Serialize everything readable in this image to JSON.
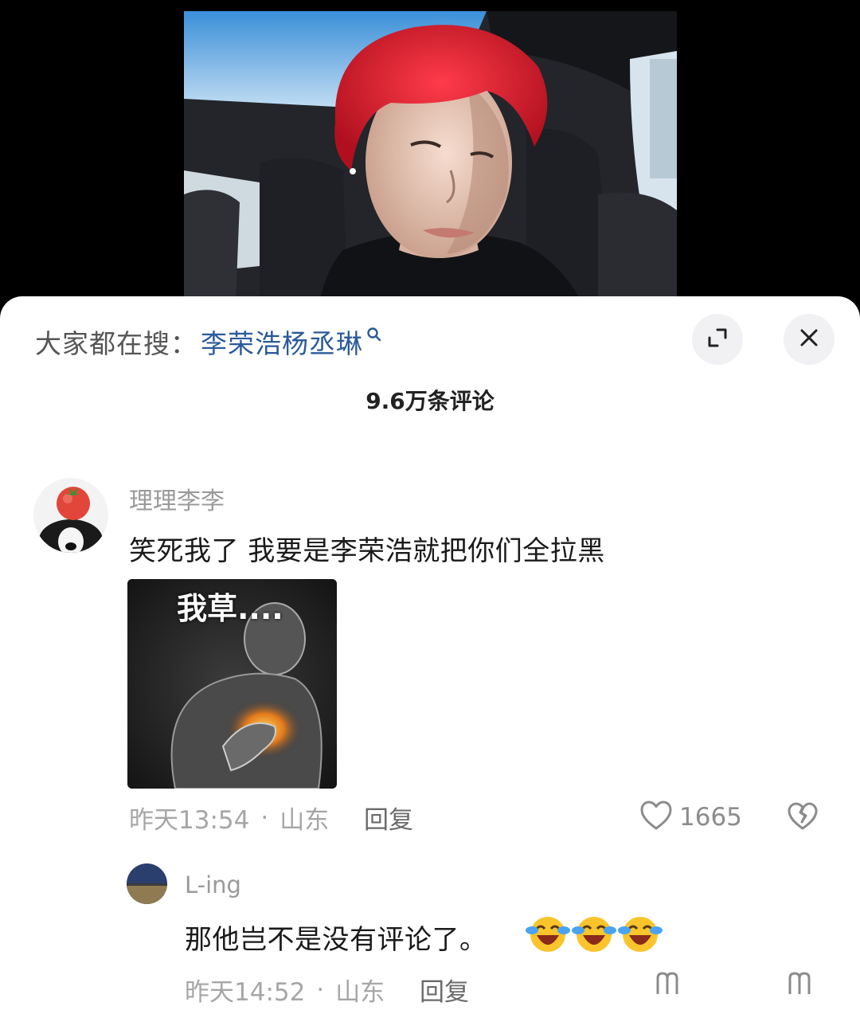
{
  "search": {
    "prefix": "大家都在搜：",
    "query": "李荣浩杨丞琳"
  },
  "comments_header": {
    "count_label": "9.6万条评论"
  },
  "comments": [
    {
      "username": "理理李李",
      "text": "笑死我了 我要是李荣浩就把你们全拉黑",
      "image_caption": "我草....",
      "time": "昨天13:54",
      "location": "山东",
      "reply_label": "回复",
      "likes": "1665"
    }
  ],
  "replies": [
    {
      "username": "L-ing",
      "text": "那他岂不是没有评论了。",
      "emoji": "laughing-crying-face",
      "emoji_count": 3,
      "time": "昨天14:52",
      "location": "山东",
      "reply_label": "回复"
    }
  ],
  "icons": {
    "search": "magnifier-icon",
    "expand": "expand-icon",
    "close": "close-icon",
    "like": "heart-icon",
    "dislike": "broken-heart-icon"
  },
  "colors": {
    "link": "#2a5a9a",
    "muted": "#a6a6a6",
    "text": "#1a1a1a"
  }
}
